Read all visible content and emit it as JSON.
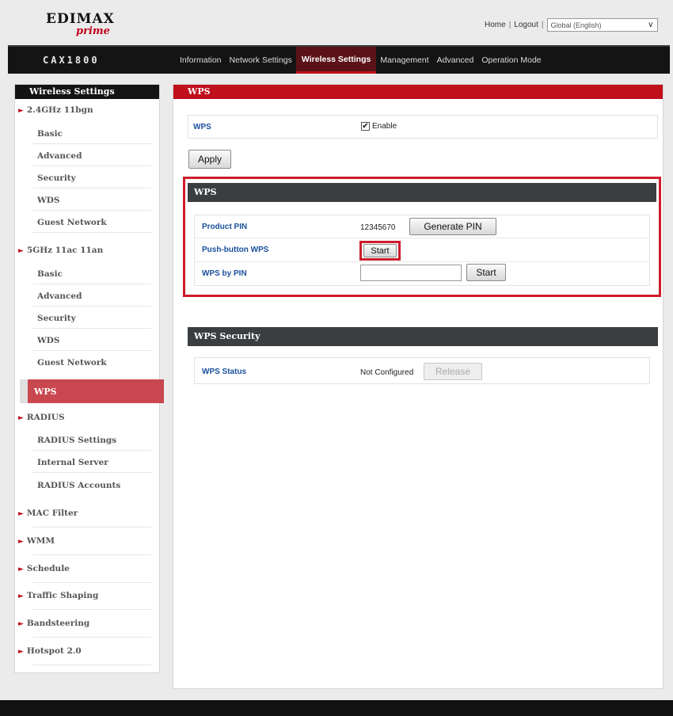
{
  "header": {
    "logo_main": "EDIMAX",
    "logo_sub": "prime",
    "home_link": "Home",
    "logout_link": "Logout",
    "separator": "|",
    "language": "Global (English)"
  },
  "nav": {
    "model": "CAX1800",
    "items": [
      "Information",
      "Network Settings",
      "Wireless Settings",
      "Management",
      "Advanced",
      "Operation Mode"
    ],
    "active": "Wireless Settings"
  },
  "sidebar": {
    "title": "Wireless Settings",
    "items": [
      {
        "label": "2.4GHz 11bgn",
        "type": "top"
      },
      {
        "label": "Basic",
        "type": "sub"
      },
      {
        "label": "Advanced",
        "type": "sub"
      },
      {
        "label": "Security",
        "type": "sub"
      },
      {
        "label": "WDS",
        "type": "sub"
      },
      {
        "label": "Guest Network",
        "type": "sub"
      },
      {
        "label": "5GHz 11ac 11an",
        "type": "top"
      },
      {
        "label": "Basic",
        "type": "sub"
      },
      {
        "label": "Advanced",
        "type": "sub"
      },
      {
        "label": "Security",
        "type": "sub"
      },
      {
        "label": "WDS",
        "type": "sub"
      },
      {
        "label": "Guest Network",
        "type": "sub"
      },
      {
        "label": "WPS",
        "type": "active"
      },
      {
        "label": "RADIUS",
        "type": "top"
      },
      {
        "label": "RADIUS Settings",
        "type": "sub"
      },
      {
        "label": "Internal Server",
        "type": "sub"
      },
      {
        "label": "RADIUS Accounts",
        "type": "sub"
      },
      {
        "label": "MAC Filter",
        "type": "top"
      },
      {
        "label": "WMM",
        "type": "top"
      },
      {
        "label": "Schedule",
        "type": "top"
      },
      {
        "label": "Traffic Shaping",
        "type": "top"
      },
      {
        "label": "Bandsteering",
        "type": "top"
      },
      {
        "label": "Hotspot 2.0",
        "type": "top"
      }
    ]
  },
  "content": {
    "title": "WPS",
    "wps_label": "WPS",
    "wps_enable_label": "Enable",
    "wps_enabled": true,
    "apply_label": "Apply",
    "wps_section": {
      "title": "WPS",
      "product_pin_label": "Product PIN",
      "product_pin_value": "12345670",
      "generate_pin_label": "Generate PIN",
      "push_button_label": "Push-button WPS",
      "push_start_label": "Start",
      "wps_by_pin_label": "WPS by PIN",
      "wps_by_pin_value": "",
      "pin_start_label": "Start"
    },
    "security_section": {
      "title": "WPS Security",
      "status_label": "WPS Status",
      "status_value": "Not Configured",
      "release_label": "Release"
    }
  },
  "colors": {
    "accent_red": "#c0101c",
    "nav_dark": "#141414",
    "section_header": "#3b3e40",
    "link_blue": "#1a4f9c"
  }
}
